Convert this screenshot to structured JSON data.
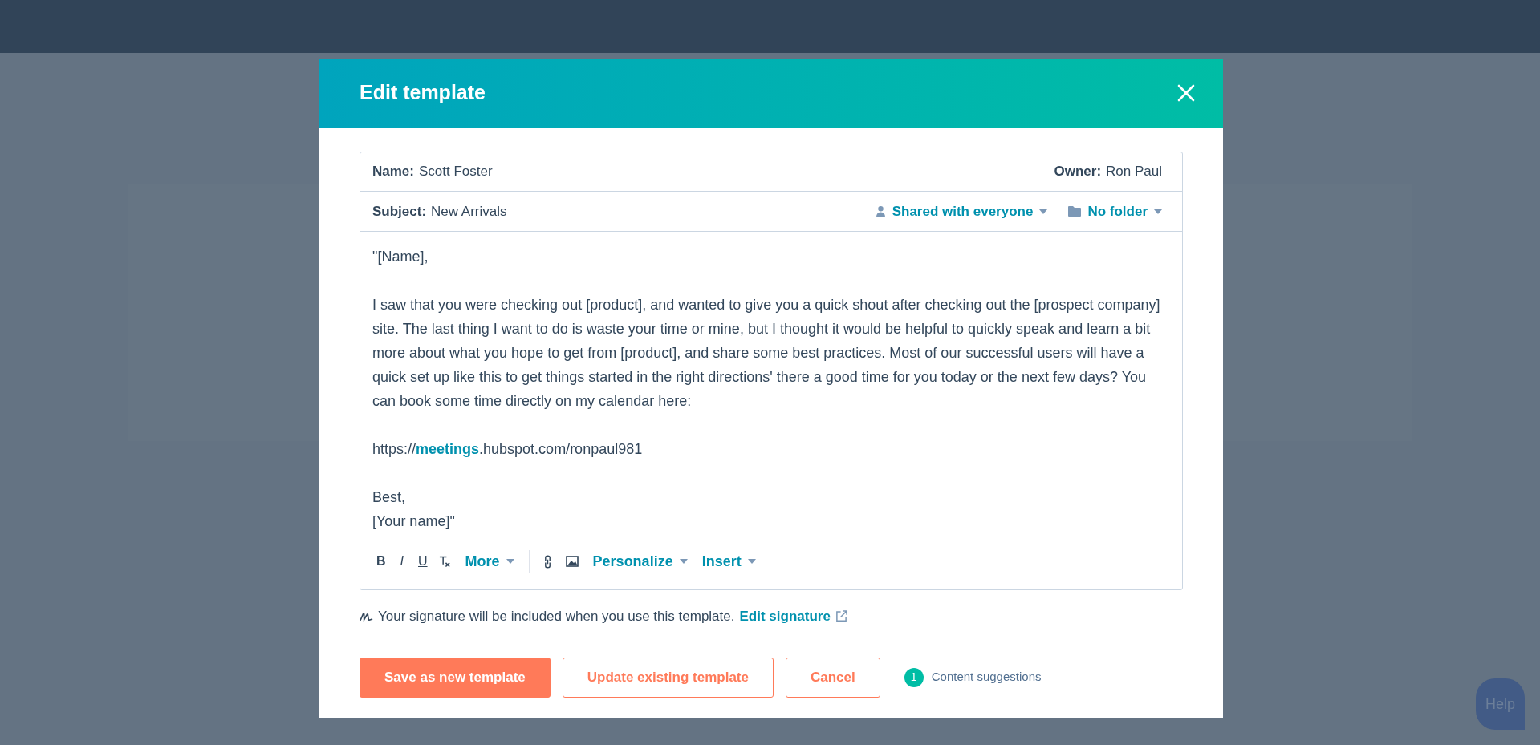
{
  "dialog": {
    "title": "Edit template"
  },
  "fields": {
    "name_label": "Name:",
    "name_value": "Scott Foster",
    "owner_label": "Owner:",
    "owner_value": "Ron Paul",
    "subject_label": "Subject:",
    "subject_value": "New Arrivals",
    "sharing": "Shared with everyone",
    "folder": "No folder"
  },
  "body": [
    [
      "\"[Name],"
    ],
    [
      "I saw that you were checking out [product], and wanted to give you a quick shout after checking out the [prospect company] site. The last thing I want to do is waste your time or mine, but I thought it would be helpful to quickly speak and learn a bit more about what you hope to get from [product], and share some best practices. Most of our successful users will have a quick set up like this to get things started in the right directions' there a good time for you today or the next few days? You can book some time directly on my calendar here:"
    ],
    [
      "https://**meetings**.hubspot.com/ronpaul981"
    ],
    [
      "Best,",
      "[Your name]\""
    ]
  ],
  "toolbar": {
    "format_buttons": [
      "B",
      "I",
      "U"
    ],
    "more": "More",
    "personalize": "Personalize",
    "insert": "Insert"
  },
  "signature": {
    "text": "Your signature will be included when you use this template.",
    "link": "Edit signature"
  },
  "buttons": [
    {
      "label": "Save as new template",
      "kind": "primary"
    },
    {
      "label": "Update existing template",
      "kind": "secondary"
    },
    {
      "label": "Cancel",
      "kind": "secondary"
    }
  ],
  "suggestions": {
    "count": "1",
    "label": "Content suggestions"
  },
  "help": {
    "label": "Help"
  }
}
